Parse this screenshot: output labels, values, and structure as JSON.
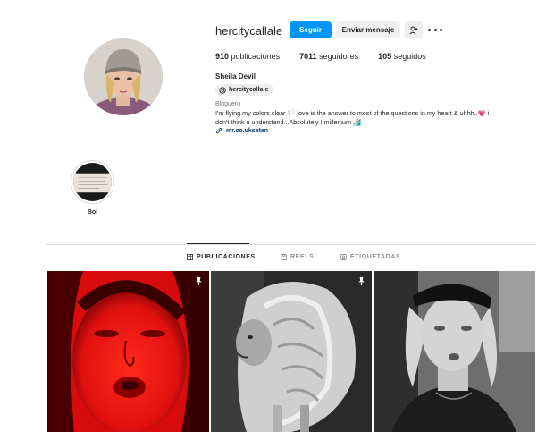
{
  "profile": {
    "username": "hercitycallale",
    "full_name": "Sheila Devil",
    "threads_handle": "hercitycallale",
    "category": "Bloguero",
    "bio_line1": "I'm flying my colors clear 🏳️ love is the answer to most of the questions in my heart & uhhh..",
    "bio_heart": "💗",
    "bio_line1_end": " i",
    "bio_line2": "don't think u understand...Absolutely ! millenium ",
    "bio_surf": "🏄",
    "link": "mr.co.uksatan"
  },
  "actions": {
    "follow_label": "Seguir",
    "message_label": "Enviar mensaje"
  },
  "stats": {
    "posts_count": "910",
    "posts_label": "publicaciones",
    "followers_count": "7011",
    "followers_label": "seguidores",
    "following_count": "105",
    "following_label": "seguidos"
  },
  "highlights": [
    {
      "label": "Boi"
    }
  ],
  "tabs": [
    {
      "label": "PUBLICACIONES",
      "icon": "grid-icon",
      "active": true
    },
    {
      "label": "REELS",
      "icon": "reels-icon",
      "active": false
    },
    {
      "label": "ETIQUETADAS",
      "icon": "tagged-icon",
      "active": false
    }
  ],
  "posts": [
    {
      "description": "red-tinted face",
      "pinned": true
    },
    {
      "description": "lion",
      "pinned": true
    },
    {
      "description": "black and white portrait",
      "pinned": false
    }
  ],
  "colors": {
    "accent": "#0095f6",
    "link": "#00376b",
    "secondary_text": "#737373"
  }
}
